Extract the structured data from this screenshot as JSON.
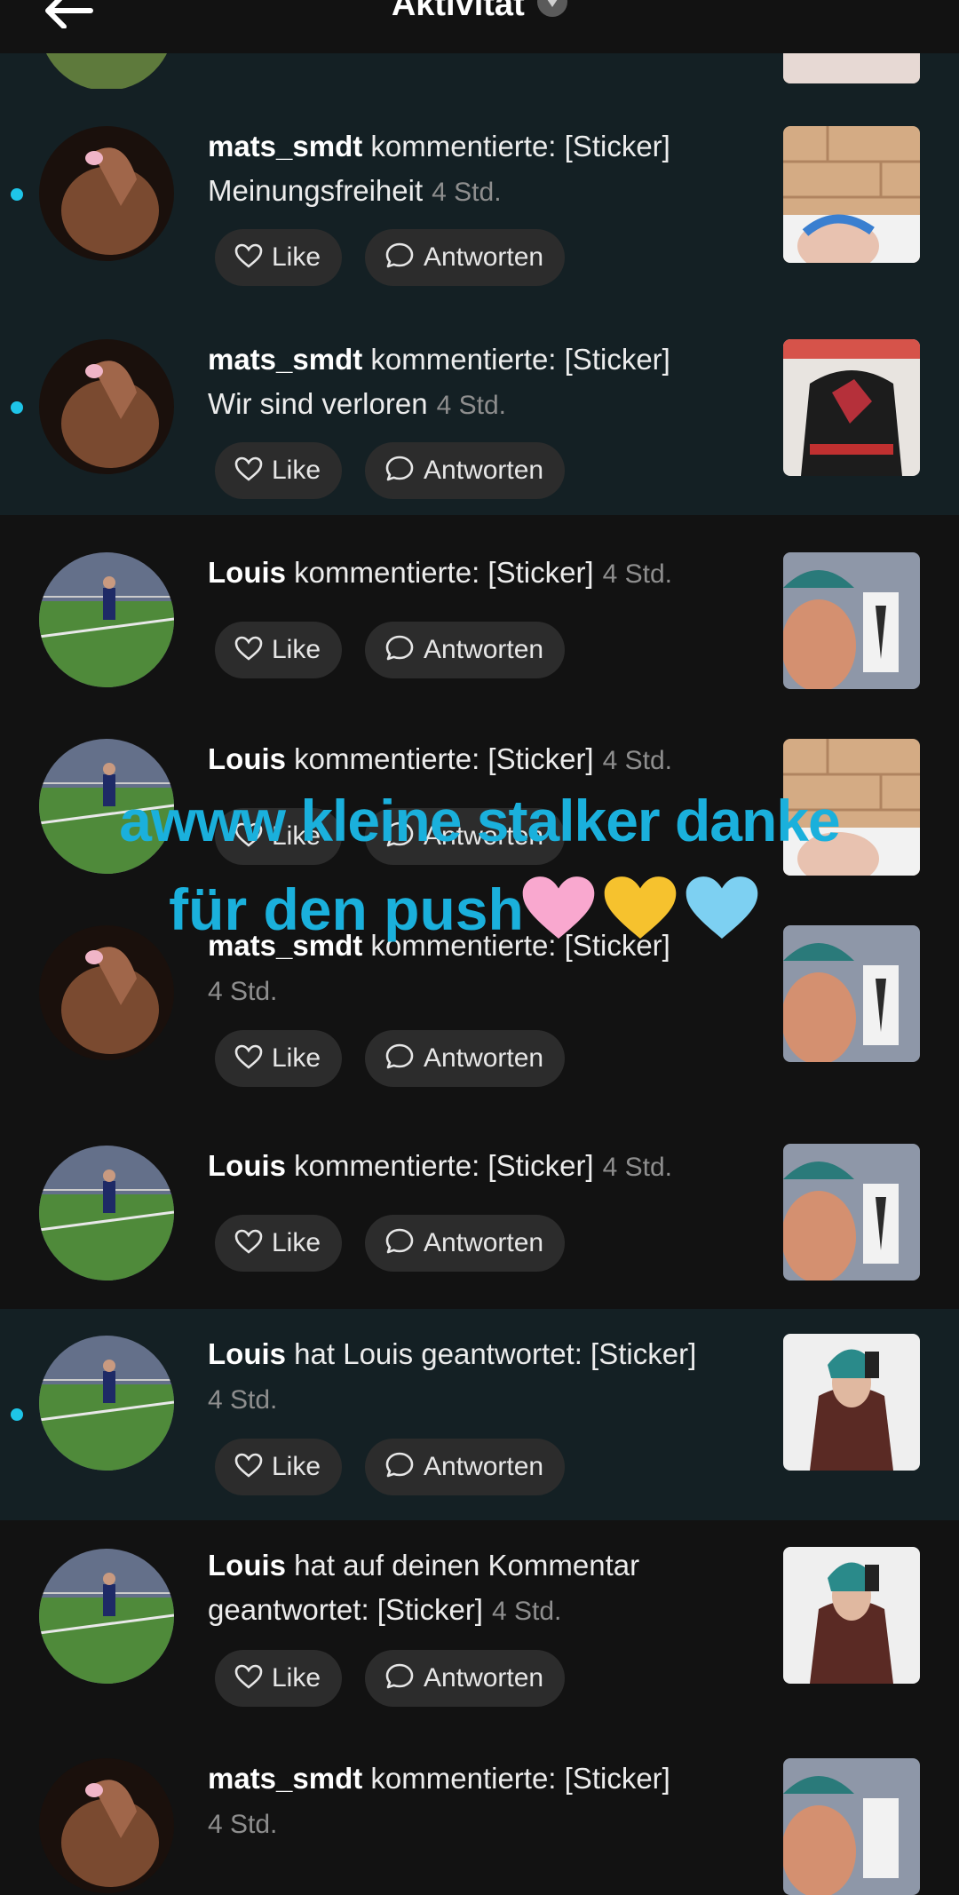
{
  "header": {
    "title": "Aktivität",
    "back_icon": "back-arrow-icon",
    "dropdown_icon": "chevron-down-icon"
  },
  "actions": {
    "like_label": "Like",
    "reply_label": "Antworten"
  },
  "notifications": [
    {
      "user": "mats_smdt",
      "action": " kommentierte: [Sticker]",
      "line2": "Meinungsfreiheit",
      "time": "4 Std.",
      "unread": true
    },
    {
      "user": "mats_smdt",
      "action": " kommentierte: [Sticker]",
      "line2": "Wir sind verloren",
      "time": "4 Std.",
      "unread": true
    },
    {
      "user": "Louis",
      "action": " kommentierte: [Sticker]",
      "line2": "",
      "time": "4 Std.",
      "unread": false
    },
    {
      "user": "Louis",
      "action": " kommentierte: [Sticker]",
      "line2": "",
      "time": "4 Std.",
      "unread": false
    },
    {
      "user": "mats_smdt",
      "action": " kommentierte: [Sticker]",
      "line2": "",
      "time": "4 Std.",
      "unread": false
    },
    {
      "user": "Louis",
      "action": " kommentierte: [Sticker]",
      "line2": "",
      "time": "4 Std.",
      "unread": false
    },
    {
      "user": "Louis",
      "action": " hat Louis geantwortet: [Sticker]",
      "line2": "",
      "time": "4 Std.",
      "unread": true
    },
    {
      "user": "Louis",
      "action": " hat auf deinen Kommentar",
      "line2": "geantwortet: [Sticker]",
      "time": "4 Std.",
      "unread": false
    },
    {
      "user": "mats_smdt",
      "action": " kommentierte: [Sticker]",
      "line2": "",
      "time": "4 Std.",
      "unread": false
    }
  ],
  "overlay": {
    "line1": "awww kleine stalker danke",
    "line2": "für den push",
    "emoji": [
      "pink-heart",
      "yellow-heart",
      "light-blue-heart"
    ]
  },
  "colors": {
    "background": "#121212",
    "unread_background": "#142024",
    "unread_dot": "#1ec5e8",
    "overlay_text": "#1ab0dc"
  }
}
